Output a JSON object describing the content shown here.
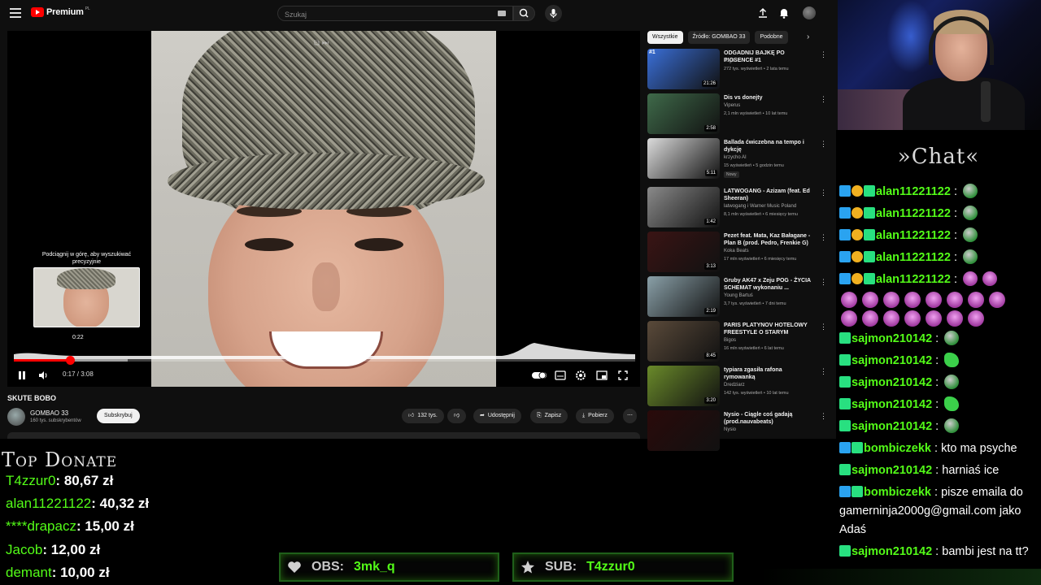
{
  "youtube": {
    "logo_text": "Premium",
    "logo_region": "PL",
    "search_placeholder": "Szukaj",
    "video": {
      "title": "SKUTE BOBO",
      "time": "0:17 / 3:08",
      "progress_fraction": 0.09,
      "preview_hint": "Podciągnij w górę, aby wyszukiwać precyzyjnie",
      "preview_time": "0:22"
    },
    "channel": {
      "name": "GOMBAO 33",
      "subs": "160 tys. subskrybentów",
      "subscribe_label": "Subskrybuj"
    },
    "actions": {
      "likes": "132 tys.",
      "share": "Udostępnij",
      "save": "Zapisz",
      "download": "Pobierz"
    },
    "chips": [
      "Wszystkie",
      "Źródło: GOMBAO 33",
      "Podobne"
    ],
    "recommendations": [
      {
        "rank": "#1",
        "title": "ODGADNIJ BAJKĘ PO PIOSENCE #1",
        "channel": "Jogis",
        "meta": "272 tys. wyświetleń • 2 lata temu",
        "duration": "21:26",
        "color": "#3a6fd8"
      },
      {
        "title": "Dis vs donejty",
        "channel": "Viperus",
        "meta": "2,1 mln wyświetleń • 10 lat temu",
        "duration": "2:58",
        "color": "#3f6a4a"
      },
      {
        "title": "Ballada ćwiczebna na tempo i dykcję",
        "channel": "krzycho AI",
        "meta": "15 wyświetleń • 5 godzin temu",
        "duration": "5:11",
        "badge": "Nowy",
        "color": "#dcdcdc"
      },
      {
        "title": "LATWOGANG - Azizam (feat. Ed Sheeran)",
        "channel": "latwogang i Warner Music Poland",
        "meta": "8,1 mln wyświetleń • 6 miesięcy temu",
        "duration": "1:42",
        "color": "#8a8a8a"
      },
      {
        "title": "Pezet feat. Mata, Kaz Bałagane - Plan B (prod. Pedro, Frenkie G)",
        "channel": "Koka Beats",
        "meta": "17 mln wyświetleń • 6 miesięcy temu",
        "duration": "3:13",
        "color": "#3a1414"
      },
      {
        "title": "Gruby AK47 x Zeju POG - ŻYCIA SCHEMAT wykonaniu ...",
        "channel": "Young Bartuś",
        "meta": "3,7 tys. wyświetleń • 7 dni temu",
        "duration": "2:19",
        "color": "#8aa0a8"
      },
      {
        "title": "PARIS PLATYNOV HOTELOWY FREESTYLE O STARYM",
        "channel": "Bigos",
        "meta": "16 mln wyświetleń • 6 lat temu",
        "duration": "8:45",
        "color": "#5a4a3a"
      },
      {
        "title": "typiara zgasiła rafona rymowanką",
        "channel": "Dredziarz",
        "meta": "142 tys. wyświetleń • 10 lat temu",
        "duration": "3:20",
        "color": "#6a8a2a"
      },
      {
        "title": "Nysio - Ciągle coś gadają (prod.nauvabeats)",
        "channel": "Nysio",
        "meta": "",
        "duration": "",
        "color": "#2a0a0a"
      }
    ]
  },
  "chat": {
    "title": "»Chat«",
    "messages": [
      {
        "user": "alan11221122",
        "text": ""
      },
      {
        "user": "alan11221122",
        "text": ""
      },
      {
        "user": "alan11221122",
        "text": ""
      },
      {
        "user": "alan11221122",
        "text": ""
      },
      {
        "user": "alan11221122",
        "text": ""
      },
      {
        "user": "sajmon210142",
        "text": ""
      },
      {
        "user": "sajmon210142",
        "text": ""
      },
      {
        "user": "sajmon210142",
        "text": ""
      },
      {
        "user": "sajmon210142",
        "text": ""
      },
      {
        "user": "sajmon210142",
        "text": ""
      },
      {
        "user": "bombiczekk",
        "text": "kto ma psyche"
      },
      {
        "user": "sajmon210142",
        "text": "harniaś ice"
      },
      {
        "user": "bombiczekk",
        "text": "pisze emaila do gamerninja2000g@gmail.com jako Adaś"
      },
      {
        "user": "sajmon210142",
        "text": "bambi jest na tt?"
      }
    ]
  },
  "overlay": {
    "donate_title": "Top Donate",
    "donors": [
      {
        "name": "T4zzur0",
        "amount": "80,67 zł"
      },
      {
        "name": "alan11221122",
        "amount": "40,32 zł"
      },
      {
        "name": "****drapacz",
        "amount": "15,00 zł"
      },
      {
        "name": "Jacob",
        "amount": "12,00 zł"
      },
      {
        "name": "demant",
        "amount": "10,00 zł"
      }
    ],
    "obs_label": "OBS:",
    "obs_value": "3mk_q",
    "sub_label": "SUB:",
    "sub_value": "T4zzur0"
  }
}
